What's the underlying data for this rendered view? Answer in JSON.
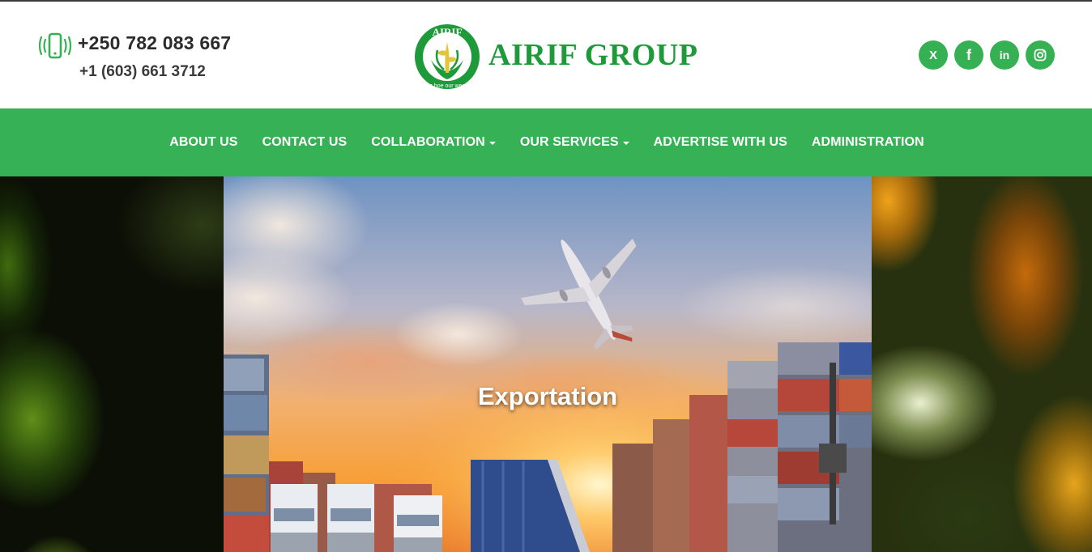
{
  "header": {
    "phone_primary": "+250 782 083 667",
    "phone_secondary": "+1 (603) 661 3712",
    "phone_icon": "mobile-phone-icon",
    "logo": {
      "brand": "AIRIF GROUP",
      "emblem_text": "AIRIF",
      "emblem_slogan": "Our hoe our wealth"
    },
    "socials": [
      {
        "name": "x-icon",
        "glyph": "X"
      },
      {
        "name": "facebook-icon",
        "glyph": "f"
      },
      {
        "name": "linkedin-icon",
        "glyph": "in"
      },
      {
        "name": "instagram-icon",
        "glyph": ""
      }
    ]
  },
  "nav": {
    "items": [
      {
        "label": "ABOUT US",
        "dropdown": false
      },
      {
        "label": "CONTACT US",
        "dropdown": false
      },
      {
        "label": "COLLABORATION",
        "dropdown": true
      },
      {
        "label": "OUR SERVICES",
        "dropdown": true
      },
      {
        "label": "ADVERTISE WITH US",
        "dropdown": false
      },
      {
        "label": "ADMINISTRATION",
        "dropdown": false
      }
    ]
  },
  "hero": {
    "caption": "Exportation"
  },
  "colors": {
    "brand_green": "#36b155",
    "logo_green": "#1e9a3a",
    "text_dark": "#2b2b2b"
  }
}
